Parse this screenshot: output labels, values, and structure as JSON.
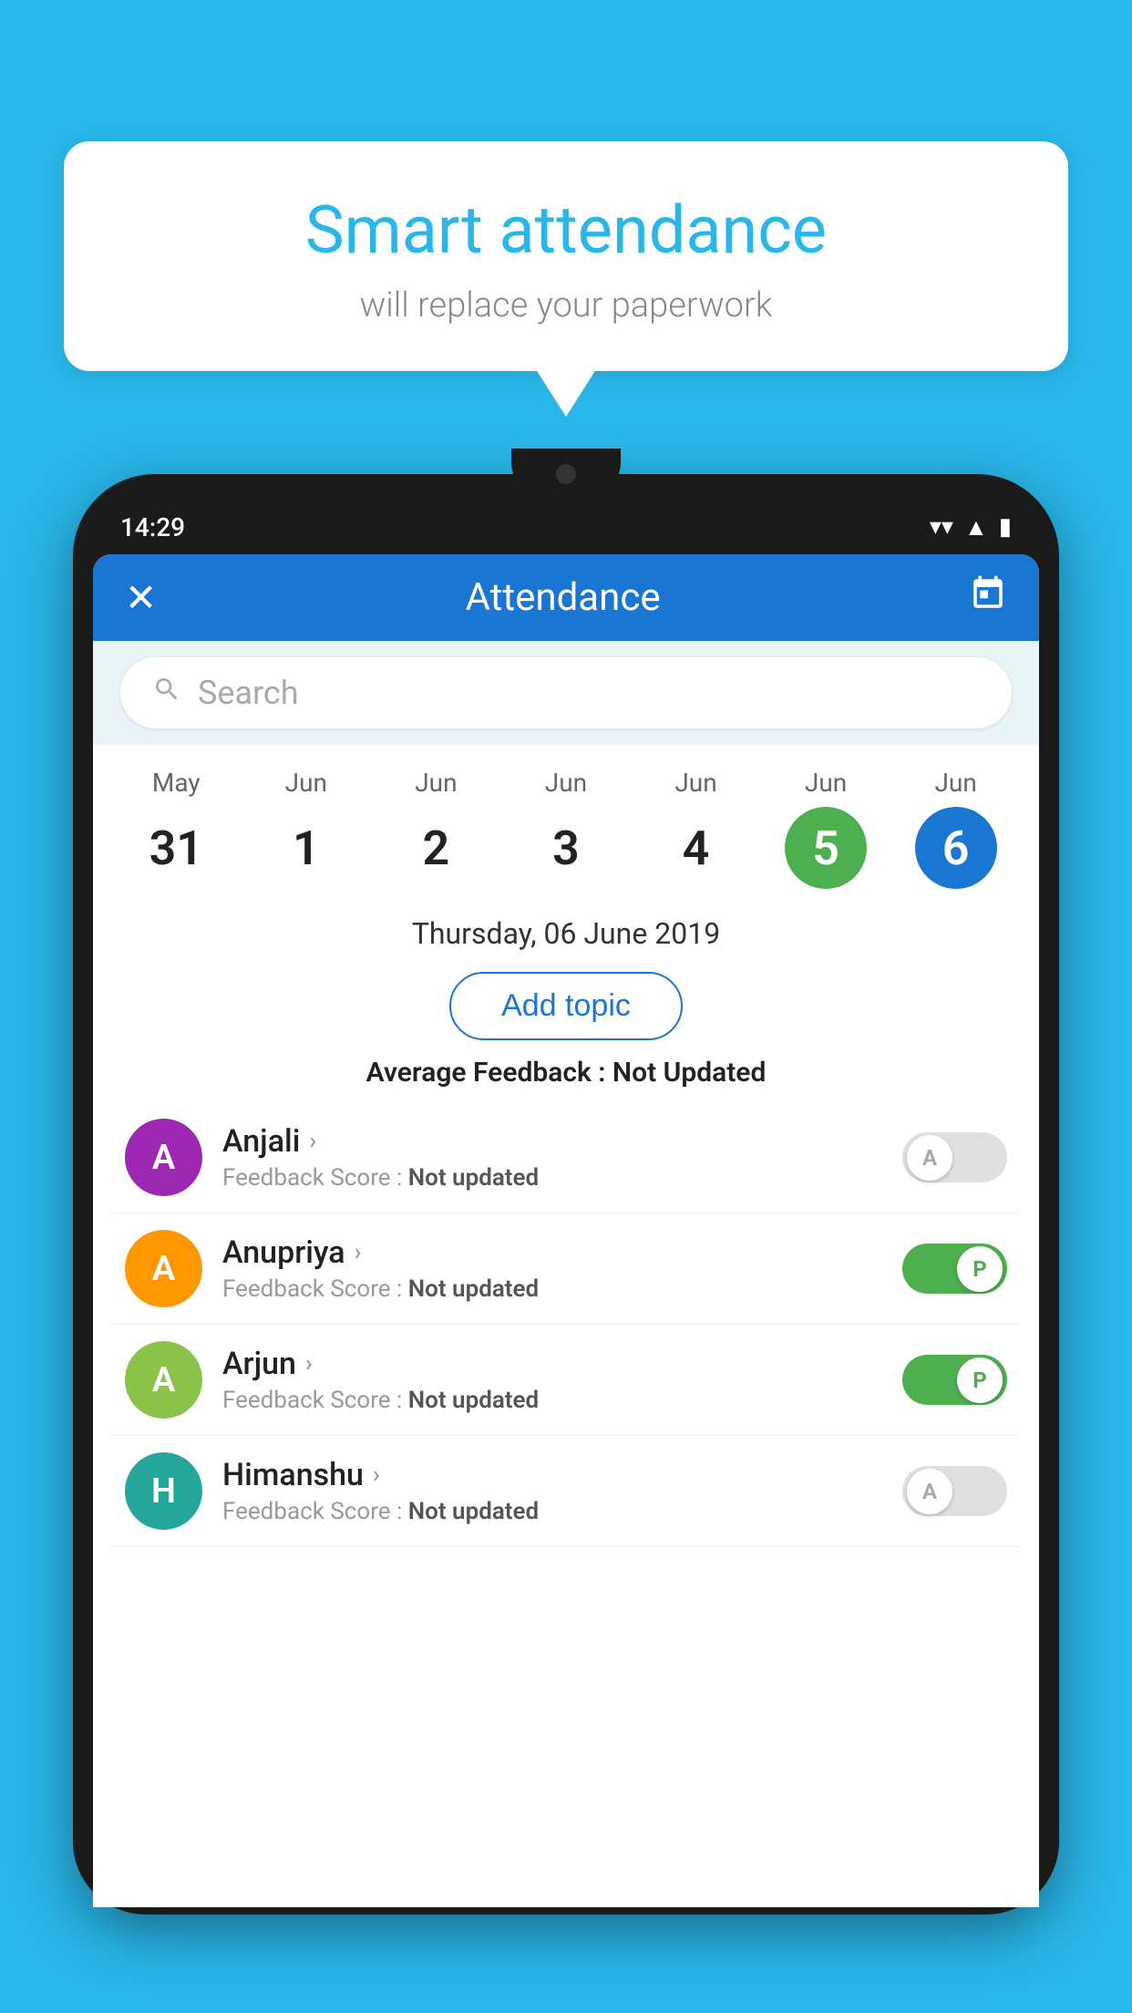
{
  "background_color": "#29b6e8",
  "bubble": {
    "title": "Smart attendance",
    "subtitle": "will replace your paperwork"
  },
  "status_bar": {
    "time": "14:29",
    "wifi": "▼",
    "signal": "◂",
    "battery": "▮"
  },
  "app_header": {
    "title": "Attendance",
    "close_icon": "✕",
    "calendar_icon": "📅"
  },
  "search": {
    "placeholder": "Search"
  },
  "calendar": {
    "days": [
      {
        "month": "May",
        "date": "31",
        "state": "normal"
      },
      {
        "month": "Jun",
        "date": "1",
        "state": "normal"
      },
      {
        "month": "Jun",
        "date": "2",
        "state": "normal"
      },
      {
        "month": "Jun",
        "date": "3",
        "state": "normal"
      },
      {
        "month": "Jun",
        "date": "4",
        "state": "normal"
      },
      {
        "month": "Jun",
        "date": "5",
        "state": "today"
      },
      {
        "month": "Jun",
        "date": "6",
        "state": "selected"
      }
    ]
  },
  "selected_date": "Thursday, 06 June 2019",
  "add_topic_label": "Add topic",
  "avg_feedback_label": "Average Feedback :",
  "avg_feedback_value": "Not Updated",
  "students": [
    {
      "name": "Anjali",
      "avatar_letter": "A",
      "avatar_color": "purple",
      "feedback_label": "Feedback Score :",
      "feedback_value": "Not updated",
      "attendance": "absent",
      "toggle_label": "A"
    },
    {
      "name": "Anupriya",
      "avatar_letter": "A",
      "avatar_color": "orange",
      "feedback_label": "Feedback Score :",
      "feedback_value": "Not updated",
      "attendance": "present",
      "toggle_label": "P"
    },
    {
      "name": "Arjun",
      "avatar_letter": "A",
      "avatar_color": "green",
      "feedback_label": "Feedback Score :",
      "feedback_value": "Not updated",
      "attendance": "present",
      "toggle_label": "P"
    },
    {
      "name": "Himanshu",
      "avatar_letter": "H",
      "avatar_color": "teal",
      "feedback_label": "Feedback Score :",
      "feedback_value": "Not updated",
      "attendance": "absent",
      "toggle_label": "A"
    }
  ]
}
